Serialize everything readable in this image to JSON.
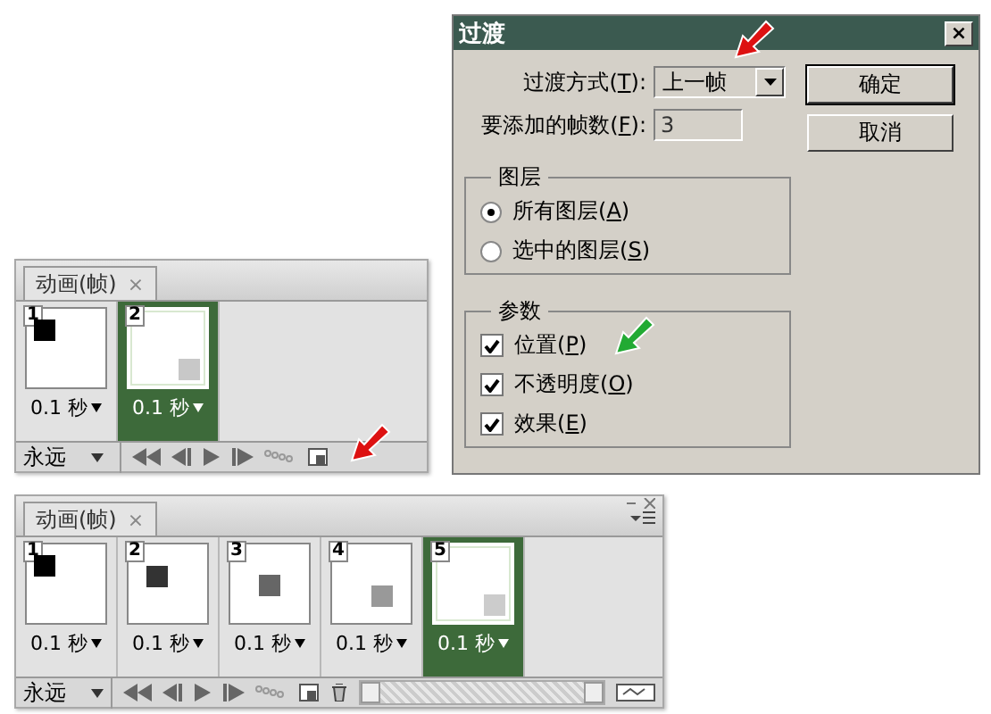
{
  "panels": [
    {
      "tab": {
        "label": "动画(帧)",
        "close": "×"
      },
      "loop": "永远",
      "tools": [
        {
          "kind": "first"
        },
        {
          "kind": "previous"
        },
        {
          "kind": "play"
        },
        {
          "kind": "next"
        },
        {
          "kind": "tween"
        },
        {
          "kind": "new"
        }
      ],
      "frames": [
        {
          "number": "1",
          "delay": "0.1 秒",
          "selected": false,
          "color": "#000000"
        },
        {
          "number": "2",
          "delay": "0.1 秒",
          "selected": true,
          "color": "#c8c8c8"
        }
      ]
    },
    {
      "tab": {
        "label": "动画(帧)",
        "close": "×"
      },
      "window_controls": true,
      "loop": "永远",
      "tools": [
        {
          "kind": "first"
        },
        {
          "kind": "previous"
        },
        {
          "kind": "play"
        },
        {
          "kind": "next"
        },
        {
          "kind": "tween"
        },
        {
          "kind": "new"
        },
        {
          "kind": "delete"
        },
        {
          "kind": "scrollbar"
        },
        {
          "kind": "timeline"
        }
      ],
      "frames": [
        {
          "number": "1",
          "delay": "0.1 秒",
          "selected": false,
          "color": "#000000"
        },
        {
          "number": "2",
          "delay": "0.1 秒",
          "selected": false,
          "color": "#333333"
        },
        {
          "number": "3",
          "delay": "0.1 秒",
          "selected": false,
          "color": "#666666"
        },
        {
          "number": "4",
          "delay": "0.1 秒",
          "selected": false,
          "color": "#999999"
        },
        {
          "number": "5",
          "delay": "0.1 秒",
          "selected": true,
          "color": "#cccccc"
        }
      ]
    }
  ],
  "dialog": {
    "title": "过渡",
    "close": "×",
    "tween_with": {
      "label": {
        "before": "过渡方式(",
        "key": "T",
        "after": "):"
      },
      "value": "上一帧"
    },
    "frames_to_add": {
      "label": {
        "before": "要添加的帧数(",
        "key": "F",
        "after": "):"
      },
      "value": "3",
      "disabled": true
    },
    "buttons": [
      "确定",
      "取消"
    ],
    "layers": {
      "title": "图层",
      "options": [
        {
          "label": {
            "before": "所有图层(",
            "key": "A",
            "after": ")"
          },
          "selected": true
        },
        {
          "label": {
            "before": "选中的图层(",
            "key": "S",
            "after": ")"
          },
          "selected": false
        }
      ]
    },
    "parameters": {
      "title": "参数",
      "options": [
        {
          "label": {
            "before": "位置(",
            "key": "P",
            "after": ")"
          },
          "checked": true
        },
        {
          "label": {
            "before": "不透明度(",
            "key": "O",
            "after": ")"
          },
          "checked": true
        },
        {
          "label": {
            "before": "效果(",
            "key": "E",
            "after": ")"
          },
          "checked": true
        }
      ]
    }
  }
}
